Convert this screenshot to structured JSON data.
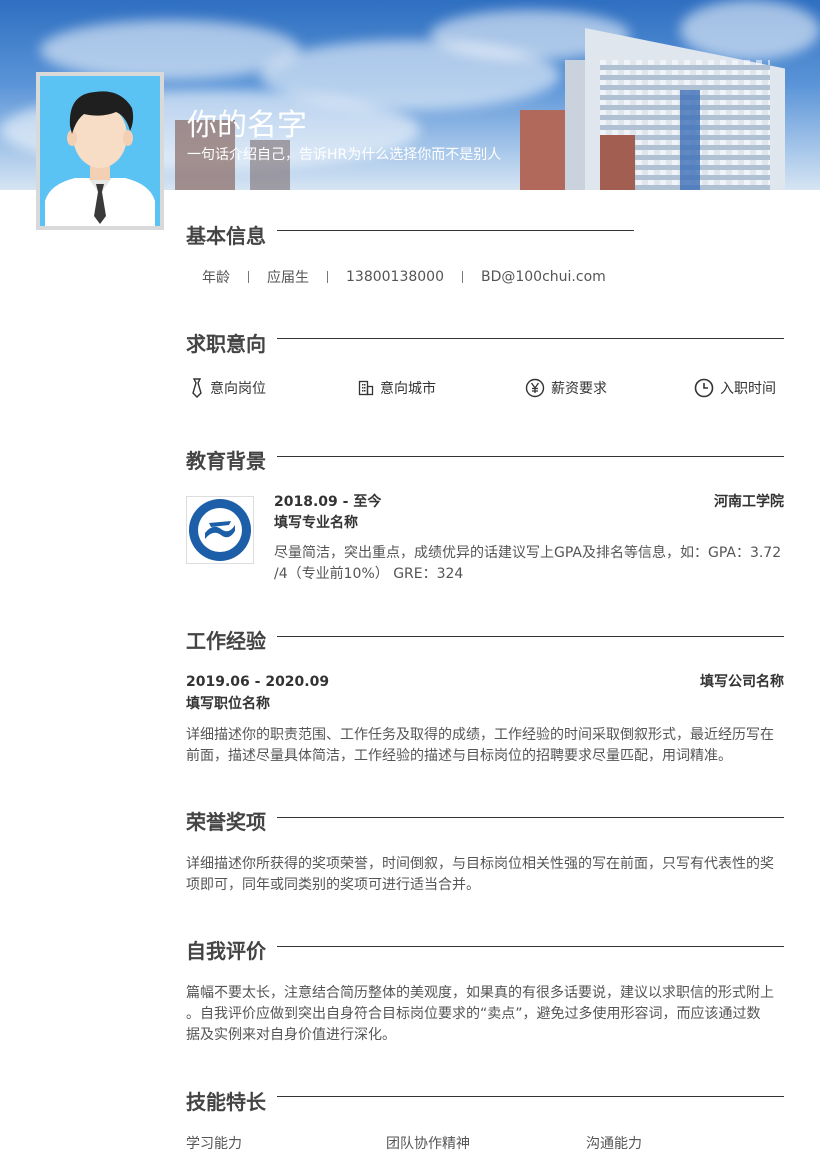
{
  "header": {
    "name": "你的名字",
    "tagline": "一句话介绍自己，告诉HR为什么选择你而不是别人"
  },
  "sections": {
    "basic": "基本信息",
    "intent": "求职意向",
    "education": "教育背景",
    "work": "工作经验",
    "honors": "荣誉奖项",
    "self": "自我评价",
    "skills": "技能特长"
  },
  "basic_info": {
    "age": "年龄",
    "status": "应届生",
    "phone": "13800138000",
    "email": "BD@100chui.com"
  },
  "intent": {
    "position": {
      "label": "意向岗位",
      "icon": "tie-icon"
    },
    "city": {
      "label": "意向城市",
      "icon": "building-icon"
    },
    "salary": {
      "label": "薪资要求",
      "icon": "yen-icon"
    },
    "start": {
      "label": "入职时间",
      "icon": "clock-icon"
    }
  },
  "education": {
    "period": "2018.09 - 至今",
    "school": "河南工学院",
    "major": "填写专业名称",
    "desc_line1": "尽量简洁，突出重点，成绩优异的话建议写上GPA及排名等信息，如：GPA：3.72",
    "desc_line2": "/4（专业前10%） GRE：324"
  },
  "work": {
    "period": "2019.06 - 2020.09",
    "company": "填写公司名称",
    "title": "填写职位名称",
    "desc_line1": "详细描述你的职责范围、工作任务及取得的成绩，工作经验的时间采取倒叙形式，最近经历写在",
    "desc_line2": "前面，描述尽量具体简洁，工作经验的描述与目标岗位的招聘要求尽量匹配，用词精准。"
  },
  "honors": {
    "desc_line1": "详细描述你所获得的奖项荣誉，时间倒叙，与目标岗位相关性强的写在前面，只写有代表性的奖",
    "desc_line2": "项即可，同年或同类别的奖项可进行适当合并。"
  },
  "self_eval": {
    "desc_line1": "篇幅不要太长，注意结合简历整体的美观度，如果真的有很多话要说，建议以求职信的形式附上",
    "desc_line2": "。自我评价应做到突出自身符合目标岗位要求的“卖点”，避免过多使用形容词，而应该通过数",
    "desc_line3": "据及实例来对自身价值进行深化。"
  },
  "skills": [
    "学习能力",
    "团队协作精神",
    "沟通能力"
  ],
  "colors": {
    "avatar_bg": "#5bc3f4",
    "text": "#333333",
    "banner": "#2f6fc1"
  }
}
